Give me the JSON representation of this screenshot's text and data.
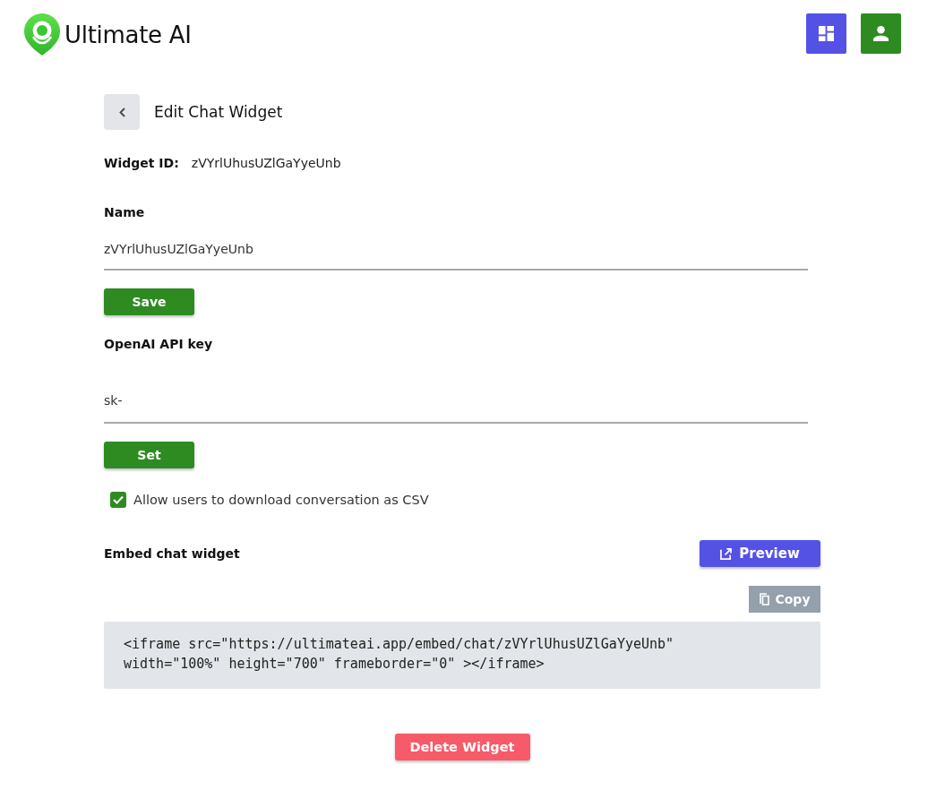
{
  "header": {
    "logo_text": "Ultimate AI"
  },
  "page": {
    "title": "Edit Chat Widget"
  },
  "widget_id": {
    "label": "Widget ID:",
    "value": "zVYrlUhusUZlGaYyeUnb"
  },
  "name_field": {
    "label": "Name",
    "value": "zVYrlUhusUZlGaYyeUnb",
    "button": "Save"
  },
  "api_key_field": {
    "label": "OpenAI API key",
    "value": "sk-",
    "button": "Set"
  },
  "csv_option": {
    "label": "Allow users to download conversation as CSV",
    "checked": true
  },
  "embed": {
    "label": "Embed chat widget",
    "preview_button": "Preview",
    "copy_button": "Copy",
    "code": "<iframe src=\"https://ultimateai.app/embed/chat/zVYrlUhusUZlGaYyeUnb\"\nwidth=\"100%\" height=\"700\" frameborder=\"0\" ></iframe>"
  },
  "delete_button": "Delete Widget"
}
